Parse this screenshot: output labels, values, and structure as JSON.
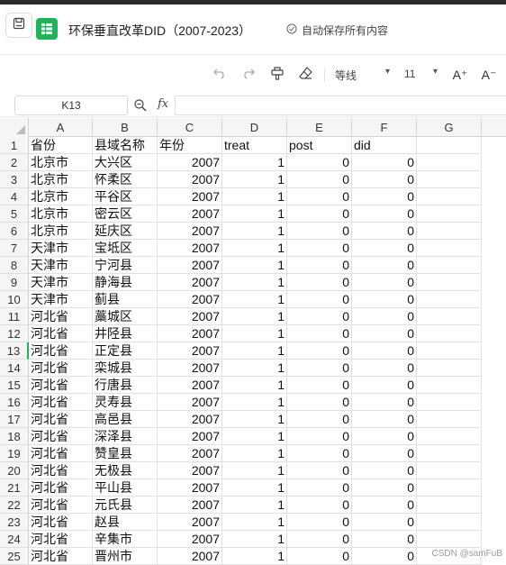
{
  "title_bar": {
    "doc_title": "环保垂直改革DID（2007-2023）",
    "autosave": "自动保存所有内容"
  },
  "toolbar": {
    "font_name": "等线",
    "font_size": "11",
    "increase_font": "A⁺",
    "decrease_font": "A⁻"
  },
  "formula_bar": {
    "name_box": "K13",
    "fx": "fx"
  },
  "columns": [
    "A",
    "B",
    "C",
    "D",
    "E",
    "F",
    "G"
  ],
  "selected_row": 13,
  "rows": [
    {
      "num": "1",
      "cells": [
        "省份",
        "县域名称",
        "年份",
        "treat",
        "post",
        "did"
      ]
    },
    {
      "num": "2",
      "cells": [
        "北京市",
        "大兴区",
        "2007",
        "1",
        "0",
        "0"
      ]
    },
    {
      "num": "3",
      "cells": [
        "北京市",
        "怀柔区",
        "2007",
        "1",
        "0",
        "0"
      ]
    },
    {
      "num": "4",
      "cells": [
        "北京市",
        "平谷区",
        "2007",
        "1",
        "0",
        "0"
      ]
    },
    {
      "num": "5",
      "cells": [
        "北京市",
        "密云区",
        "2007",
        "1",
        "0",
        "0"
      ]
    },
    {
      "num": "6",
      "cells": [
        "北京市",
        "延庆区",
        "2007",
        "1",
        "0",
        "0"
      ]
    },
    {
      "num": "7",
      "cells": [
        "天津市",
        "宝坻区",
        "2007",
        "1",
        "0",
        "0"
      ]
    },
    {
      "num": "8",
      "cells": [
        "天津市",
        "宁河县",
        "2007",
        "1",
        "0",
        "0"
      ]
    },
    {
      "num": "9",
      "cells": [
        "天津市",
        "静海县",
        "2007",
        "1",
        "0",
        "0"
      ]
    },
    {
      "num": "10",
      "cells": [
        "天津市",
        "蓟县",
        "2007",
        "1",
        "0",
        "0"
      ]
    },
    {
      "num": "11",
      "cells": [
        "河北省",
        "藁城区",
        "2007",
        "1",
        "0",
        "0"
      ]
    },
    {
      "num": "12",
      "cells": [
        "河北省",
        "井陉县",
        "2007",
        "1",
        "0",
        "0"
      ]
    },
    {
      "num": "13",
      "cells": [
        "河北省",
        "正定县",
        "2007",
        "1",
        "0",
        "0"
      ]
    },
    {
      "num": "14",
      "cells": [
        "河北省",
        "栾城县",
        "2007",
        "1",
        "0",
        "0"
      ]
    },
    {
      "num": "15",
      "cells": [
        "河北省",
        "行唐县",
        "2007",
        "1",
        "0",
        "0"
      ]
    },
    {
      "num": "16",
      "cells": [
        "河北省",
        "灵寿县",
        "2007",
        "1",
        "0",
        "0"
      ]
    },
    {
      "num": "17",
      "cells": [
        "河北省",
        "高邑县",
        "2007",
        "1",
        "0",
        "0"
      ]
    },
    {
      "num": "18",
      "cells": [
        "河北省",
        "深泽县",
        "2007",
        "1",
        "0",
        "0"
      ]
    },
    {
      "num": "19",
      "cells": [
        "河北省",
        "赞皇县",
        "2007",
        "1",
        "0",
        "0"
      ]
    },
    {
      "num": "20",
      "cells": [
        "河北省",
        "无极县",
        "2007",
        "1",
        "0",
        "0"
      ]
    },
    {
      "num": "21",
      "cells": [
        "河北省",
        "平山县",
        "2007",
        "1",
        "0",
        "0"
      ]
    },
    {
      "num": "22",
      "cells": [
        "河北省",
        "元氏县",
        "2007",
        "1",
        "0",
        "0"
      ]
    },
    {
      "num": "23",
      "cells": [
        "河北省",
        "赵县",
        "2007",
        "1",
        "0",
        "0"
      ]
    },
    {
      "num": "24",
      "cells": [
        "河北省",
        "辛集市",
        "2007",
        "1",
        "0",
        "0"
      ]
    },
    {
      "num": "25",
      "cells": [
        "河北省",
        "晋州市",
        "2007",
        "1",
        "0",
        "0"
      ]
    }
  ],
  "watermark": "CSDN @samFuB",
  "colors": {
    "accent": "#1fb35a",
    "header_bg": "#f5f5f5",
    "grid_line": "#e1e1e1"
  }
}
